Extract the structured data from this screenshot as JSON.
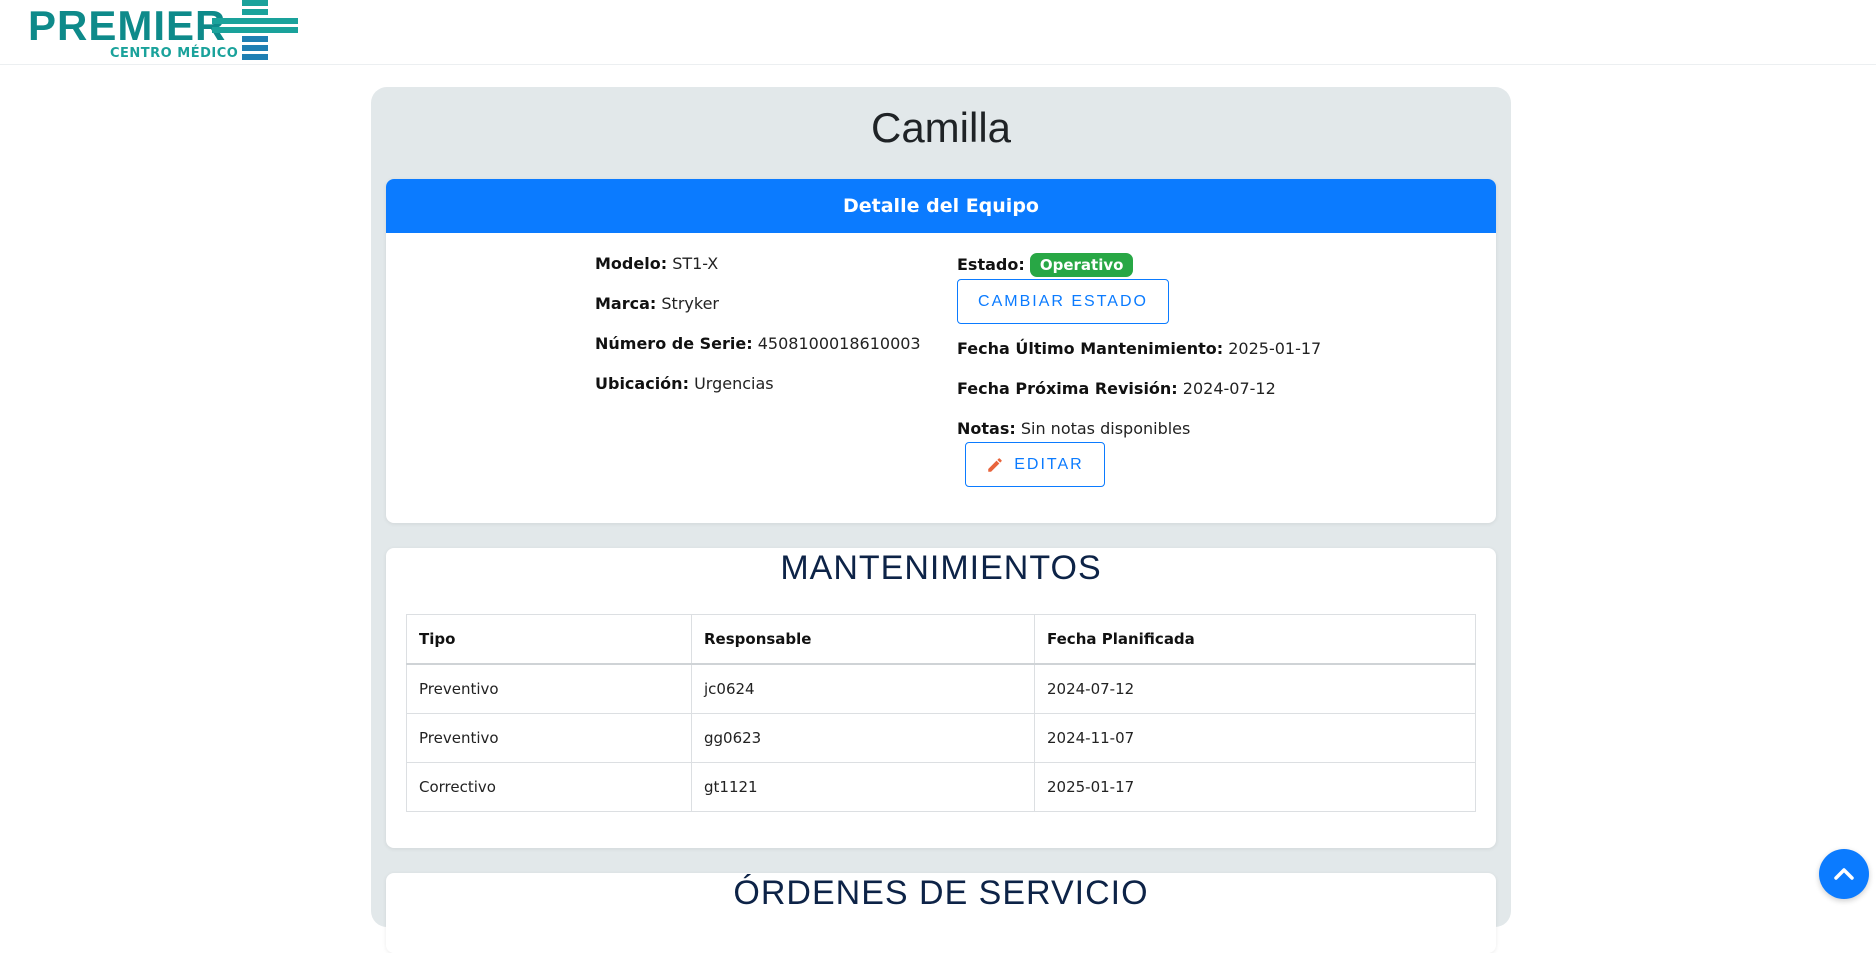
{
  "brand": {
    "name": "PREMIER",
    "subtitle": "CENTRO MÉDICO",
    "colors": {
      "teal": "#0e8a8a",
      "green": "#1aa29b"
    }
  },
  "equipment": {
    "title": "Camilla"
  },
  "detail": {
    "header": "Detalle del Equipo",
    "modelo_label": "Modelo:",
    "modelo_value": "ST1-X",
    "marca_label": "Marca:",
    "marca_value": "Stryker",
    "serie_label": "Número de Serie:",
    "serie_value": "4508100018610003",
    "ubicacion_label": "Ubicación:",
    "ubicacion_value": "Urgencias",
    "estado_label": "Estado:",
    "estado_value": "Operativo",
    "cambiar_estado_label": "CAMBIAR ESTADO",
    "ultimo_mant_label": "Fecha Último Mantenimiento:",
    "ultimo_mant_value": "2025-01-17",
    "proxima_rev_label": "Fecha Próxima Revisión:",
    "proxima_rev_value": "2024-07-12",
    "notas_label": "Notas:",
    "notas_value": "Sin notas disponibles",
    "editar_label": "EDITAR",
    "colors": {
      "primary": "#0b7bff",
      "success": "#28a745"
    }
  },
  "mantenimientos": {
    "title": "MANTENIMIENTOS",
    "headers": [
      "Tipo",
      "Responsable",
      "Fecha Planificada"
    ],
    "rows": [
      [
        "Preventivo",
        "jc0624",
        "2024-07-12"
      ],
      [
        "Preventivo",
        "gg0623",
        "2024-11-07"
      ],
      [
        "Correctivo",
        "gt1121",
        "2025-01-17"
      ]
    ]
  },
  "ordenes": {
    "title": "ÓRDENES DE SERVICIO"
  },
  "icons": {
    "edit": "pencil-icon",
    "scroll_top": "chevron-up-icon"
  }
}
